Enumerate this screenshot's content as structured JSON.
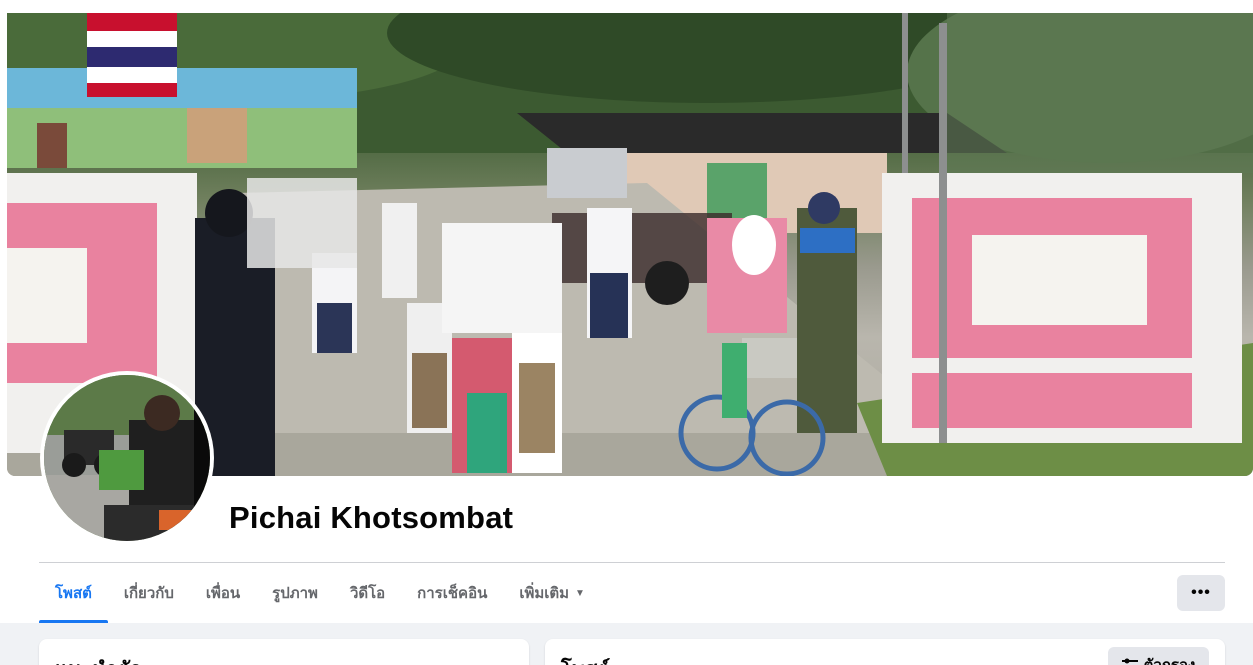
{
  "profile": {
    "name": "Pichai Khotsombat"
  },
  "tabs": [
    {
      "label": "โพสต์",
      "active": true
    },
    {
      "label": "เกี่ยวกับ",
      "active": false
    },
    {
      "label": "เพื่อน",
      "active": false
    },
    {
      "label": "รูปภาพ",
      "active": false
    },
    {
      "label": "วิดีโอ",
      "active": false
    },
    {
      "label": "การเช็คอิน",
      "active": false
    },
    {
      "label": "เพิ่มเติม",
      "active": false
    }
  ],
  "more_button": {
    "label": "•••"
  },
  "intro_card": {
    "title": "แนะนำตัว"
  },
  "posts_card": {
    "title": "โพสต์",
    "filter_label": "ตัวกรอง"
  },
  "colors": {
    "accent": "#1877f2",
    "tab_text": "#65676b",
    "button_bg": "#e4e6eb",
    "page_bg": "#f0f2f5"
  }
}
